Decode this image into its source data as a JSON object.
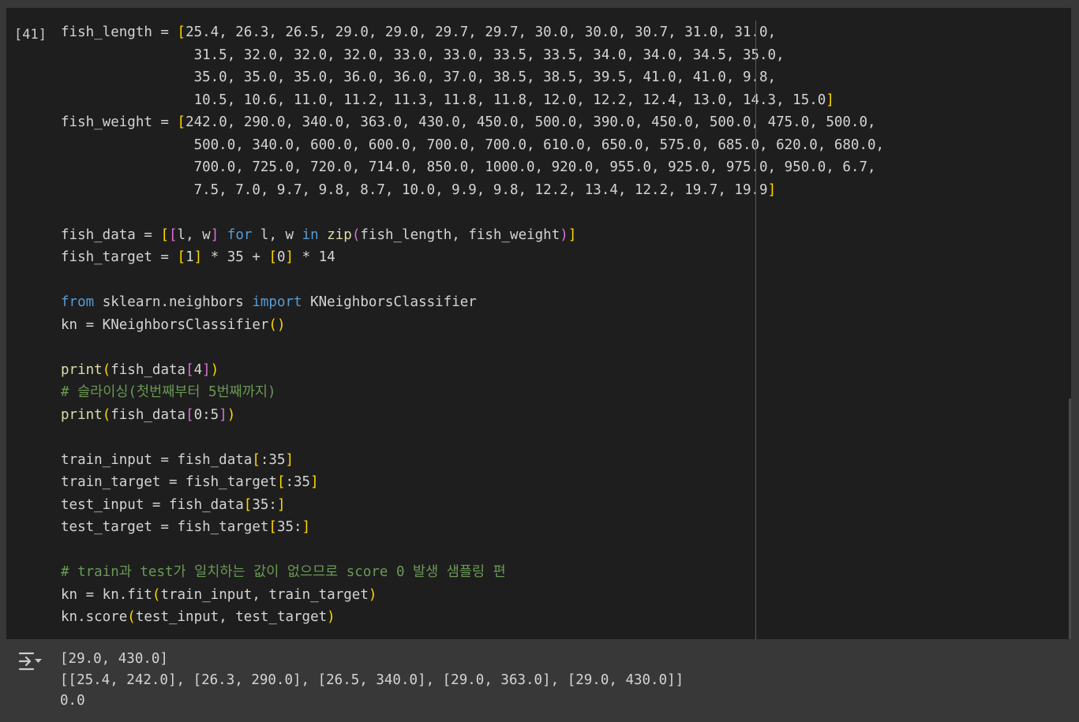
{
  "cell": {
    "execution_count": "[41]",
    "lines": [
      [
        {
          "t": "fish_length = "
        },
        {
          "t": "[",
          "c": "br"
        },
        {
          "t": "25.4, 26.3, 26.5, 29.0, 29.0, 29.7, 29.7, 30.0, 30.0, 30.7, 31.0, 31.0,"
        }
      ],
      [
        {
          "t": "                31.5, 32.0, 32.0, 32.0, 33.0, 33.0, 33.5, 33.5, 34.0, 34.0, 34.5, 35.0,"
        }
      ],
      [
        {
          "t": "                35.0, 35.0, 35.0, 36.0, 36.0, 37.0, 38.5, 38.5, 39.5, 41.0, 41.0, 9.8,"
        }
      ],
      [
        {
          "t": "                10.5, 10.6, 11.0, 11.2, 11.3, 11.8, 11.8, 12.0, 12.2, 12.4, 13.0, 14.3, 15.0"
        },
        {
          "t": "]",
          "c": "br"
        }
      ],
      [
        {
          "t": "fish_weight = "
        },
        {
          "t": "[",
          "c": "br"
        },
        {
          "t": "242.0, 290.0, 340.0, 363.0, 430.0, 450.0, 500.0, 390.0, 450.0, 500.0, 475.0, 500.0,"
        }
      ],
      [
        {
          "t": "                500.0, 340.0, 600.0, 600.0, 700.0, 700.0, 610.0, 650.0, 575.0, 685.0, 620.0, 680.0,"
        }
      ],
      [
        {
          "t": "                700.0, 725.0, 720.0, 714.0, 850.0, 1000.0, 920.0, 955.0, 925.0, 975.0, 950.0, 6.7,"
        }
      ],
      [
        {
          "t": "                7.5, 7.0, 9.7, 9.8, 8.7, 10.0, 9.9, 9.8, 12.2, 13.4, 12.2, 19.7, 19.9"
        },
        {
          "t": "]",
          "c": "br"
        }
      ],
      [
        {
          "t": ""
        }
      ],
      [
        {
          "t": "fish_data = "
        },
        {
          "t": "[",
          "c": "br"
        },
        {
          "t": "[",
          "c": "br2"
        },
        {
          "t": "l, w"
        },
        {
          "t": "]",
          "c": "br2"
        },
        {
          "t": " "
        },
        {
          "t": "for",
          "c": "kw"
        },
        {
          "t": " l, w "
        },
        {
          "t": "in",
          "c": "kw"
        },
        {
          "t": " "
        },
        {
          "t": "zip",
          "c": "fn"
        },
        {
          "t": "(",
          "c": "br2"
        },
        {
          "t": "fish_length, fish_weight"
        },
        {
          "t": ")",
          "c": "br2"
        },
        {
          "t": "]",
          "c": "br"
        }
      ],
      [
        {
          "t": "fish_target = "
        },
        {
          "t": "[",
          "c": "br"
        },
        {
          "t": "1"
        },
        {
          "t": "]",
          "c": "br"
        },
        {
          "t": " * 35 + "
        },
        {
          "t": "[",
          "c": "br"
        },
        {
          "t": "0"
        },
        {
          "t": "]",
          "c": "br"
        },
        {
          "t": " * 14"
        }
      ],
      [
        {
          "t": ""
        }
      ],
      [
        {
          "t": "from",
          "c": "kw"
        },
        {
          "t": " sklearn.neighbors "
        },
        {
          "t": "import",
          "c": "kw"
        },
        {
          "t": " KNeighborsClassifier"
        }
      ],
      [
        {
          "t": "kn = KNeighborsClassifier"
        },
        {
          "t": "()",
          "c": "br"
        }
      ],
      [
        {
          "t": ""
        }
      ],
      [
        {
          "t": "print",
          "c": "fn"
        },
        {
          "t": "(",
          "c": "br"
        },
        {
          "t": "fish_data"
        },
        {
          "t": "[",
          "c": "br2"
        },
        {
          "t": "4"
        },
        {
          "t": "]",
          "c": "br2"
        },
        {
          "t": ")",
          "c": "br"
        }
      ],
      [
        {
          "t": "# 슬라이싱(첫번째부터 5번째까지)",
          "c": "cm"
        }
      ],
      [
        {
          "t": "print",
          "c": "fn"
        },
        {
          "t": "(",
          "c": "br"
        },
        {
          "t": "fish_data"
        },
        {
          "t": "[",
          "c": "br2"
        },
        {
          "t": "0:5"
        },
        {
          "t": "]",
          "c": "br2"
        },
        {
          "t": ")",
          "c": "br"
        }
      ],
      [
        {
          "t": ""
        }
      ],
      [
        {
          "t": "train_input = fish_data"
        },
        {
          "t": "[",
          "c": "br"
        },
        {
          "t": ":35"
        },
        {
          "t": "]",
          "c": "br"
        }
      ],
      [
        {
          "t": "train_target = fish_target"
        },
        {
          "t": "[",
          "c": "br"
        },
        {
          "t": ":35"
        },
        {
          "t": "]",
          "c": "br"
        }
      ],
      [
        {
          "t": "test_input = fish_data"
        },
        {
          "t": "[",
          "c": "br"
        },
        {
          "t": "35:"
        },
        {
          "t": "]",
          "c": "br"
        }
      ],
      [
        {
          "t": "test_target = fish_target"
        },
        {
          "t": "[",
          "c": "br"
        },
        {
          "t": "35:"
        },
        {
          "t": "]",
          "c": "br"
        }
      ],
      [
        {
          "t": ""
        }
      ],
      [
        {
          "t": "# train과 test가 일치하는 값이 없으므로 score 0 발생 샘플링 편",
          "c": "cm"
        }
      ],
      [
        {
          "t": "kn = kn.fit"
        },
        {
          "t": "(",
          "c": "br"
        },
        {
          "t": "train_input, train_target"
        },
        {
          "t": ")",
          "c": "br"
        }
      ],
      [
        {
          "t": "kn.score"
        },
        {
          "t": "(",
          "c": "br"
        },
        {
          "t": "test_input, test_target"
        },
        {
          "t": ")",
          "c": "br"
        }
      ]
    ]
  },
  "output": {
    "icon": "output-toggle-icon",
    "lines": [
      "[29.0, 430.0]",
      "[[25.4, 242.0], [26.3, 290.0], [26.5, 340.0], [29.0, 363.0], [29.0, 430.0]]",
      "0.0"
    ]
  },
  "colors": {
    "cell_bg": "#1e1e1e",
    "page_bg": "#383838",
    "keyword": "#569cd6",
    "function": "#dcdcaa",
    "comment": "#6a9955",
    "bracket_level1": "#ffd700",
    "bracket_level2": "#da70d6",
    "text": "#d4d4d4"
  }
}
